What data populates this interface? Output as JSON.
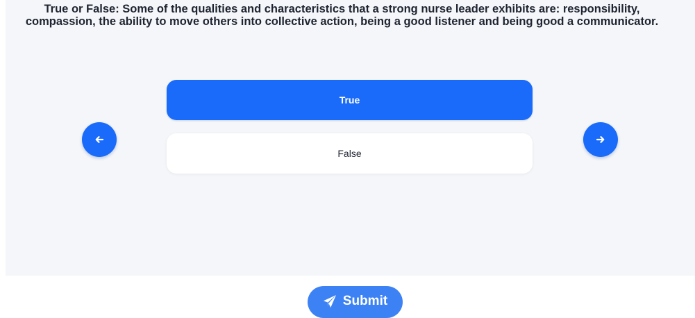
{
  "question": {
    "line1": "True or False: Some of the qualities and characteristics that a strong nurse leader exhibits are: responsibility,",
    "line2": "compassion, the ability to move others into collective action, being a good listener and being good a communicator."
  },
  "options": [
    {
      "label": "True",
      "selected": true
    },
    {
      "label": "False",
      "selected": false
    }
  ],
  "navigation": {
    "prev_icon": "arrow-left-icon",
    "next_icon": "arrow-right-icon"
  },
  "submit": {
    "label": "Submit",
    "icon": "paper-plane-icon"
  },
  "colors": {
    "accent": "#1a6bfa",
    "submit": "#3d82f5",
    "panel_background": "#f4f6f9",
    "text": "#1f2430"
  }
}
